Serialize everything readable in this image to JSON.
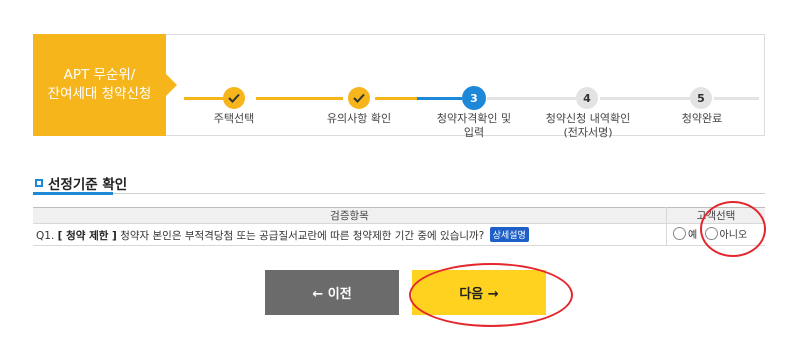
{
  "header": {
    "title_line1": "APT 무순위/",
    "title_line2": "잔여세대 청약신청"
  },
  "steps": [
    {
      "number": "",
      "line1": "주택선택",
      "line2": "",
      "state": "done"
    },
    {
      "number": "",
      "line1": "유의사항 확인",
      "line2": "",
      "state": "done"
    },
    {
      "number": "3",
      "line1": "청약자격확인 및",
      "line2": "입력",
      "state": "current"
    },
    {
      "number": "4",
      "line1": "청약신청 내역확인",
      "line2": "(전자서명)",
      "state": "todo"
    },
    {
      "number": "5",
      "line1": "청약완료",
      "line2": "",
      "state": "todo"
    }
  ],
  "section": {
    "title": "선정기준 확인"
  },
  "table": {
    "headers": [
      "검증항목",
      "고객선택"
    ],
    "rows": [
      {
        "prefix": "Q1.",
        "tag": "[ 청약 제한 ]",
        "question": "청약자 본인은 부적격당첨 또는 공급질서교란에 따른 청약제한 기간 중에 있습니까?",
        "detail_badge": "상세설명",
        "options": [
          "예",
          "아니오"
        ]
      }
    ]
  },
  "buttons": {
    "prev": "← 이전",
    "next": "다음 →"
  },
  "colors": {
    "accent_yellow": "#f5b51b",
    "accent_blue": "#1e88d8",
    "annotation_red": "#e4262d"
  }
}
